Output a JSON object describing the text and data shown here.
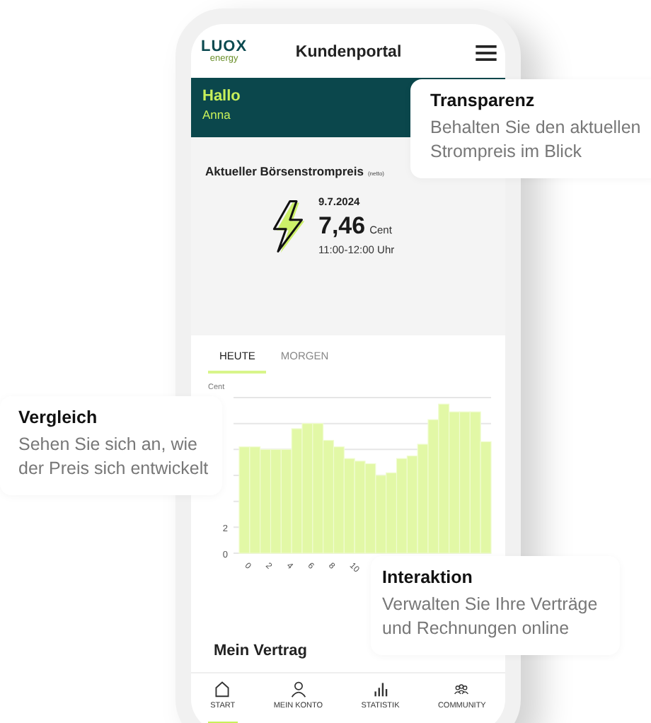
{
  "header": {
    "logo": "LUOX",
    "logo_sub": "energy",
    "title": "Kundenportal"
  },
  "greeting": {
    "title": "Hallo",
    "name": "Anna"
  },
  "price_card": {
    "title": "Aktueller Börsenstrompreis",
    "note": "(netto)",
    "date": "9.7.2024",
    "price": "7,46",
    "unit": "Cent",
    "time": "11:00-12:00 Uhr"
  },
  "tabs": [
    {
      "label": "HEUTE",
      "selected": true
    },
    {
      "label": "MORGEN",
      "selected": false
    }
  ],
  "chart": {
    "unit_label": "Cent",
    "chart_data": {
      "type": "bar",
      "x": [
        0,
        1,
        2,
        3,
        4,
        5,
        6,
        7,
        8,
        9,
        10,
        11,
        12,
        13,
        14,
        15,
        16,
        17,
        18,
        19,
        20,
        21,
        22,
        23
      ],
      "values": [
        8.2,
        8.2,
        8.0,
        8.0,
        8.0,
        9.6,
        10.0,
        10.0,
        8.7,
        8.2,
        7.3,
        7.1,
        6.9,
        6.0,
        6.2,
        7.3,
        7.5,
        8.4,
        10.3,
        11.5,
        10.9,
        10.9,
        10.9,
        8.6
      ],
      "xlim": [
        -0.5,
        23.5
      ],
      "ylim": [
        0,
        12
      ],
      "yticks": [
        0,
        2
      ],
      "xticks": [
        {
          "value": 0,
          "label": "0"
        },
        {
          "value": 2,
          "label": "2"
        },
        {
          "value": 4,
          "label": "4"
        },
        {
          "value": 6,
          "label": "6"
        },
        {
          "value": 8,
          "label": "8"
        },
        {
          "value": 10,
          "label": "10"
        }
      ]
    }
  },
  "section_title": "Mein Vertrag",
  "nav": [
    {
      "label": "START",
      "selected": true
    },
    {
      "label": "MEIN KONTO",
      "selected": false
    },
    {
      "label": "STATISTIK",
      "selected": false
    },
    {
      "label": "COMMUNITY",
      "selected": false
    }
  ],
  "callouts": [
    {
      "title": "Transparenz",
      "text": "Behalten Sie den aktuellen Strompreis im Blick"
    },
    {
      "title": "Vergleich",
      "text": "Sehen Sie sich an, wie der Preis sich entwickelt"
    },
    {
      "title": "Interaktion",
      "text": "Verwalten Sie Ihre Verträge und Rechnungen online"
    }
  ]
}
